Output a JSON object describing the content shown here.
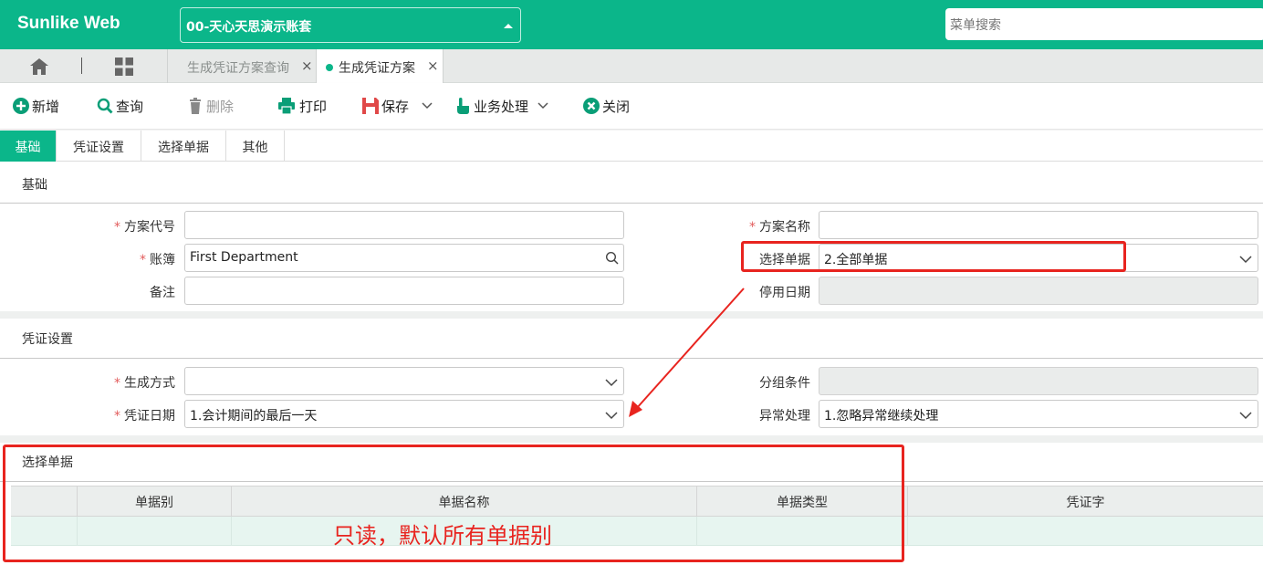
{
  "header": {
    "brand": "Sunlike Web",
    "account": "00-天心天思演示账套",
    "search_placeholder": "菜单搜索"
  },
  "tabs": [
    {
      "label": "生成凭证方案查询"
    },
    {
      "label": "生成凭证方案"
    }
  ],
  "toolbar": {
    "add": "新增",
    "query": "查询",
    "delete": "删除",
    "print": "打印",
    "save": "保存",
    "business": "业务处理",
    "close": "关闭"
  },
  "page_tabs": [
    "基础",
    "凭证设置",
    "选择单据",
    "其他"
  ],
  "basic": {
    "title": "基础",
    "scheme_code_label": "方案代号",
    "scheme_code_value": "",
    "scheme_name_label": "方案名称",
    "scheme_name_value": "",
    "ledger_label": "账簿",
    "ledger_value": "First Department",
    "select_doc_label": "选择单据",
    "select_doc_value": "2.全部单据",
    "remark_label": "备注",
    "remark_value": "",
    "disable_date_label": "停用日期",
    "disable_date_value": ""
  },
  "voucher": {
    "title": "凭证设置",
    "gen_method_label": "生成方式",
    "gen_method_value": "",
    "group_cond_label": "分组条件",
    "group_cond_value": "",
    "voucher_date_label": "凭证日期",
    "voucher_date_value": "1.会计期间的最后一天",
    "exception_label": "异常处理",
    "exception_value": "1.忽略异常继续处理"
  },
  "select_docs": {
    "title": "选择单据",
    "columns": [
      "单据别",
      "单据名称",
      "单据类型",
      "凭证字"
    ]
  },
  "annotation": {
    "text": "只读，默认所有单据别",
    "color": "#e8241f"
  },
  "colors": {
    "brand": "#0bb68a"
  }
}
